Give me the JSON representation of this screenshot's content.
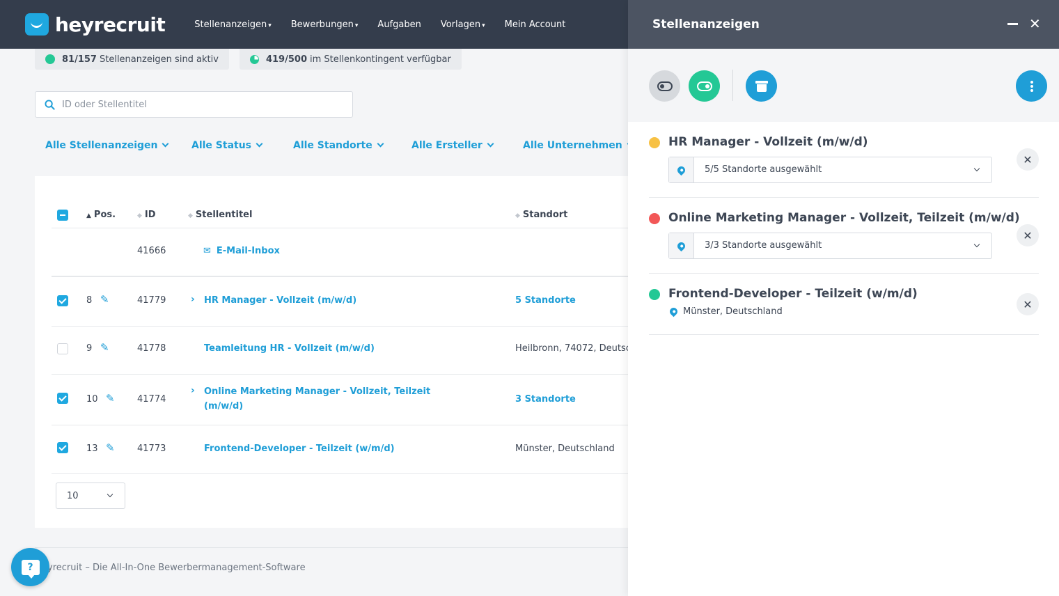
{
  "app": {
    "logo_text": "heyrecruit",
    "nav": [
      {
        "label": "Stellenanzeigen",
        "caret": "▾"
      },
      {
        "label": "Bewerbungen",
        "caret": "▾"
      },
      {
        "label": "Aufgaben",
        "caret": ""
      },
      {
        "label": "Vorlagen",
        "caret": "▾"
      },
      {
        "label": "Mein Account",
        "caret": ""
      }
    ]
  },
  "stats": {
    "active_count": "81/157",
    "active_text": "Stellenanzeigen sind aktiv",
    "quota_count": "419/500",
    "quota_text": "im Stellenkontingent verfügbar"
  },
  "search": {
    "placeholder": "ID oder Stellentitel"
  },
  "filters": [
    "Alle Stellenanzeigen",
    "Alle Status",
    "Alle Standorte",
    "Alle Ersteller",
    "Alle Unternehmen"
  ],
  "table": {
    "columns": {
      "pos": "Pos.",
      "id": "ID",
      "title": "Stellentitel",
      "location": "Standort"
    },
    "inbox": {
      "id": "41666",
      "label": "E-Mail-Inbox"
    },
    "rows": [
      {
        "checked": true,
        "pos": "8",
        "id": "41779",
        "title": "HR Manager - Vollzeit (m/w/d)",
        "title2": "",
        "expandable": true,
        "location": "5 Standorte",
        "location_link": true
      },
      {
        "checked": false,
        "pos": "9",
        "id": "41778",
        "title": "Teamleitung HR - Vollzeit (m/w/d)",
        "title2": "",
        "expandable": false,
        "location": "Heilbronn, 74072, Deutsc",
        "location_link": false
      },
      {
        "checked": true,
        "pos": "10",
        "id": "41774",
        "title": "Online Marketing Manager - Vollzeit, Teilzeit",
        "title2": "(m/w/d)",
        "expandable": true,
        "location": "3 Standorte",
        "location_link": true
      },
      {
        "checked": true,
        "pos": "13",
        "id": "41773",
        "title": "Frontend-Developer - Teilzeit (w/m/d)",
        "title2": "",
        "expandable": false,
        "location": "Münster, Deutschland",
        "location_link": false
      }
    ],
    "page_size": "10"
  },
  "footer": {
    "text": "yrecruit – Die All-In-One Bewerbermanagement-Software",
    "help_label": "?"
  },
  "panel": {
    "title": "Stellenanzeigen",
    "items": [
      {
        "status_color": "#f7c144",
        "title": "HR Manager - Vollzeit (m/w/d)",
        "locations": "5/5 Standorte ausgewählt"
      },
      {
        "status_color": "#f25757",
        "title": "Online Marketing Manager - Vollzeit, Teilzeit (m/w/d)",
        "locations": "3/3 Standorte ausgewählt"
      },
      {
        "status_color": "#24c895",
        "title": "Frontend-Developer - Teilzeit (w/m/d)",
        "location_single": "Münster, Deutschland"
      }
    ]
  },
  "colors": {
    "accent": "#1f9ed7",
    "active": "#24c895",
    "header_bg": "#343d4c",
    "panel_head_bg": "#4c5462"
  }
}
